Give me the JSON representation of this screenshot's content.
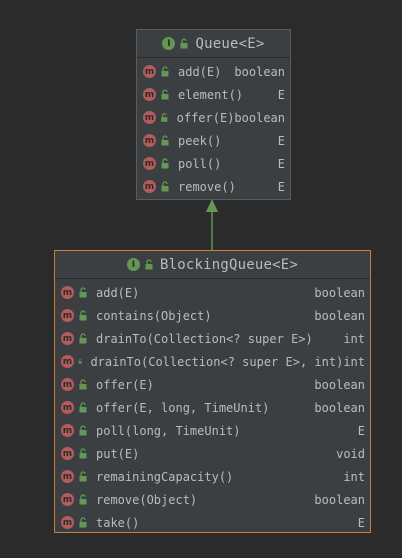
{
  "colors": {
    "background": "#2b2b2b",
    "box_fill": "#3c3f41",
    "box_border": "#5a5d60",
    "selected_border": "#c7803a",
    "interface_badge": "#629755",
    "method_badge": "#b45c5c",
    "text": "#bbbbbb",
    "arrow": "#629755"
  },
  "badges": {
    "interface_letter": "I",
    "method_letter": "m"
  },
  "queue": {
    "title": "Queue<E>",
    "methods": [
      {
        "name": "add(E)",
        "type": "boolean"
      },
      {
        "name": "element()",
        "type": "E"
      },
      {
        "name": "offer(E)",
        "type": "boolean"
      },
      {
        "name": "peek()",
        "type": "E"
      },
      {
        "name": "poll()",
        "type": "E"
      },
      {
        "name": "remove()",
        "type": "E"
      }
    ]
  },
  "blocking_queue": {
    "title": "BlockingQueue<E>",
    "methods": [
      {
        "name": "add(E)",
        "type": "boolean"
      },
      {
        "name": "contains(Object)",
        "type": "boolean"
      },
      {
        "name": "drainTo(Collection<? super E>)",
        "type": "int"
      },
      {
        "name": "drainTo(Collection<? super E>, int)",
        "type": "int"
      },
      {
        "name": "offer(E)",
        "type": "boolean"
      },
      {
        "name": "offer(E, long, TimeUnit)",
        "type": "boolean"
      },
      {
        "name": "poll(long, TimeUnit)",
        "type": "E"
      },
      {
        "name": "put(E)",
        "type": "void"
      },
      {
        "name": "remainingCapacity()",
        "type": "int"
      },
      {
        "name": "remove(Object)",
        "type": "boolean"
      },
      {
        "name": "take()",
        "type": "E"
      }
    ]
  },
  "relation": {
    "kind": "extends",
    "from": "BlockingQueue<E>",
    "to": "Queue<E>"
  }
}
